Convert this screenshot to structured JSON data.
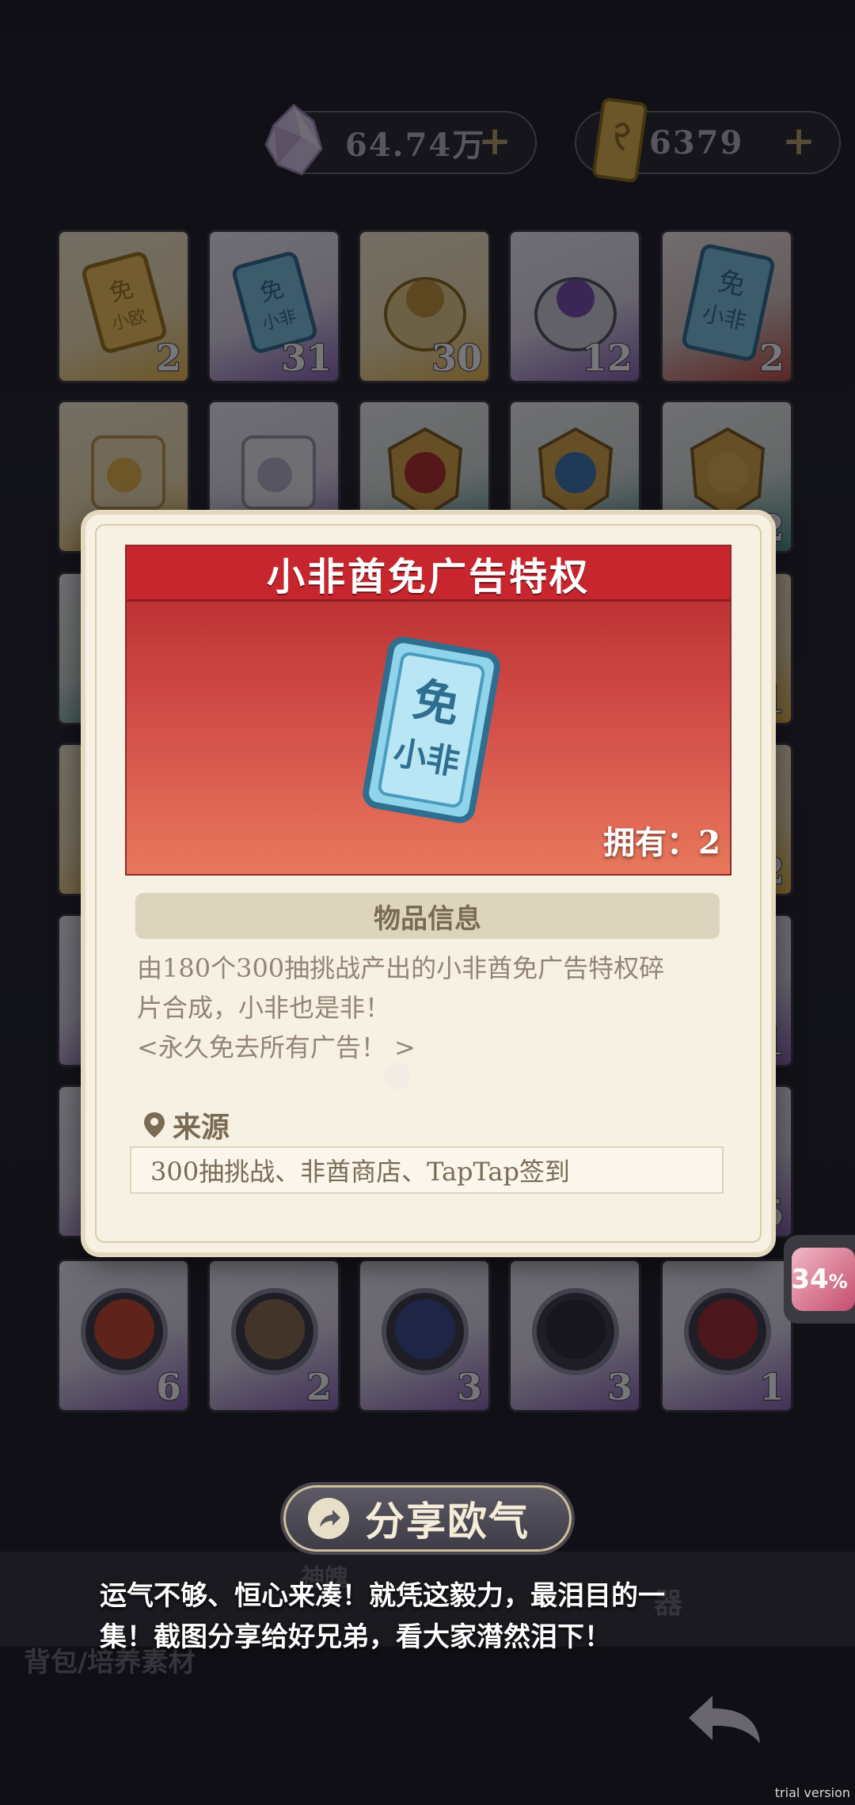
{
  "currency": {
    "crystals": "64.74万",
    "crystals_plus": "+",
    "tickets": "6379",
    "tickets_plus": "+"
  },
  "inventory": {
    "row1": [
      {
        "item": "免小欧 ticket",
        "count": "2",
        "rarity": "gold"
      },
      {
        "item": "免小非 ticket",
        "count": "31",
        "rarity": "purple"
      },
      {
        "item": "golden egg",
        "count": "30",
        "rarity": "gold"
      },
      {
        "item": "purple egg",
        "count": "12",
        "rarity": "purple"
      },
      {
        "item": "免小非 ticket large",
        "count": "2",
        "rarity": "red"
      }
    ],
    "row2": [
      {
        "item": "gold scroll",
        "count": "",
        "rarity": "gold"
      },
      {
        "item": "silver scroll",
        "count": "",
        "rarity": "purple"
      },
      {
        "item": "red shield medal",
        "count": "",
        "rarity": "teal"
      },
      {
        "item": "blue helmet medal",
        "count": "",
        "rarity": "teal"
      },
      {
        "item": "gold medal",
        "count": "2",
        "rarity": "teal"
      }
    ],
    "right_edge_counts": [
      "1",
      "2",
      "1",
      "5"
    ],
    "row_last": [
      {
        "item": "portrait red hair",
        "count": "6",
        "rarity": "purple"
      },
      {
        "item": "portrait brown hair",
        "count": "2",
        "rarity": "purple"
      },
      {
        "item": "portrait blue hair",
        "count": "3",
        "rarity": "purple"
      },
      {
        "item": "portrait dark hair",
        "count": "3",
        "rarity": "purple"
      },
      {
        "item": "portrait red cap",
        "count": "1",
        "rarity": "purple"
      }
    ]
  },
  "modal": {
    "title": "小非酋免广告特权",
    "owned_label": "拥有：2",
    "section_header": "物品信息",
    "description_line1": "由180个300抽挑战产出的小非酋免广告特权碎",
    "description_line2": "片合成，小非也是非！",
    "description_line3": "<永久免去所有广告！ >",
    "source_label": "来源",
    "source_value": "300抽挑战、非酋商店、TapTap签到",
    "ticket_text_top": "免",
    "ticket_text_bottom": "小非"
  },
  "progress_badge": {
    "value": "34",
    "unit": "%"
  },
  "share": {
    "label": "分享欧气"
  },
  "caption": {
    "line1": "运气不够、恒心来凑！就凭这毅力，最泪目的一",
    "line2": "集！截图分享给好兄弟，看大家潸然泪下！"
  },
  "bottom_tabs": {
    "backpack": "背包/培养素材",
    "divine": "神魄",
    "artifact": "器"
  },
  "watermark": "trial version",
  "colors": {
    "banner_red": "#c8262e",
    "modal_bg": "#f7f1e4",
    "accent_gold": "#cdbf9a"
  }
}
